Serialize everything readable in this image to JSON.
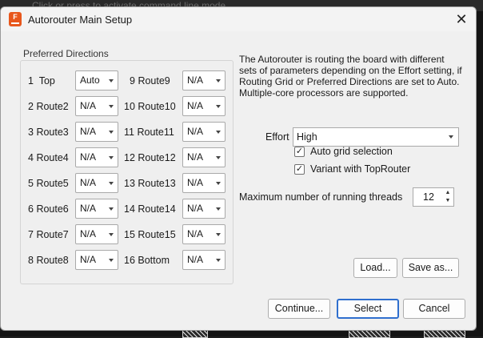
{
  "background": {
    "hint_text": "Click or press  to activate command line mode"
  },
  "window": {
    "title": "Autorouter Main Setup",
    "close_icon": "close-icon"
  },
  "preferred_directions": {
    "label": "Preferred Directions",
    "left_rows": [
      {
        "num": "1",
        "name": "Top",
        "value": "Auto"
      },
      {
        "num": "2",
        "name": "Route2",
        "value": "N/A"
      },
      {
        "num": "3",
        "name": "Route3",
        "value": "N/A"
      },
      {
        "num": "4",
        "name": "Route4",
        "value": "N/A"
      },
      {
        "num": "5",
        "name": "Route5",
        "value": "N/A"
      },
      {
        "num": "6",
        "name": "Route6",
        "value": "N/A"
      },
      {
        "num": "7",
        "name": "Route7",
        "value": "N/A"
      },
      {
        "num": "8",
        "name": "Route8",
        "value": "N/A"
      }
    ],
    "right_rows": [
      {
        "num": "9",
        "name": "Route9",
        "value": "N/A"
      },
      {
        "num": "10",
        "name": "Route10",
        "value": "N/A"
      },
      {
        "num": "11",
        "name": "Route11",
        "value": "N/A"
      },
      {
        "num": "12",
        "name": "Route12",
        "value": "N/A"
      },
      {
        "num": "13",
        "name": "Route13",
        "value": "N/A"
      },
      {
        "num": "14",
        "name": "Route14",
        "value": "N/A"
      },
      {
        "num": "15",
        "name": "Route15",
        "value": "N/A"
      },
      {
        "num": "16",
        "name": "Bottom",
        "value": "N/A"
      }
    ]
  },
  "description": "The Autorouter is routing the board with different sets of parameters depending on the Effort setting, if Routing Grid or Preferred Directions are set to Auto. Multiple-core processors are supported.",
  "effort": {
    "label": "Effort",
    "value": "High"
  },
  "checkboxes": [
    {
      "label": "Auto grid selection",
      "checked": true
    },
    {
      "label": "Variant with TopRouter",
      "checked": true
    }
  ],
  "threads": {
    "label": "Maximum number of running threads",
    "value": "12"
  },
  "buttons": {
    "load": "Load...",
    "save_as": "Save as...",
    "continue": "Continue...",
    "select": "Select",
    "cancel": "Cancel"
  },
  "colors": {
    "accent": "#2f6fce",
    "app_icon": "#e8571c"
  }
}
